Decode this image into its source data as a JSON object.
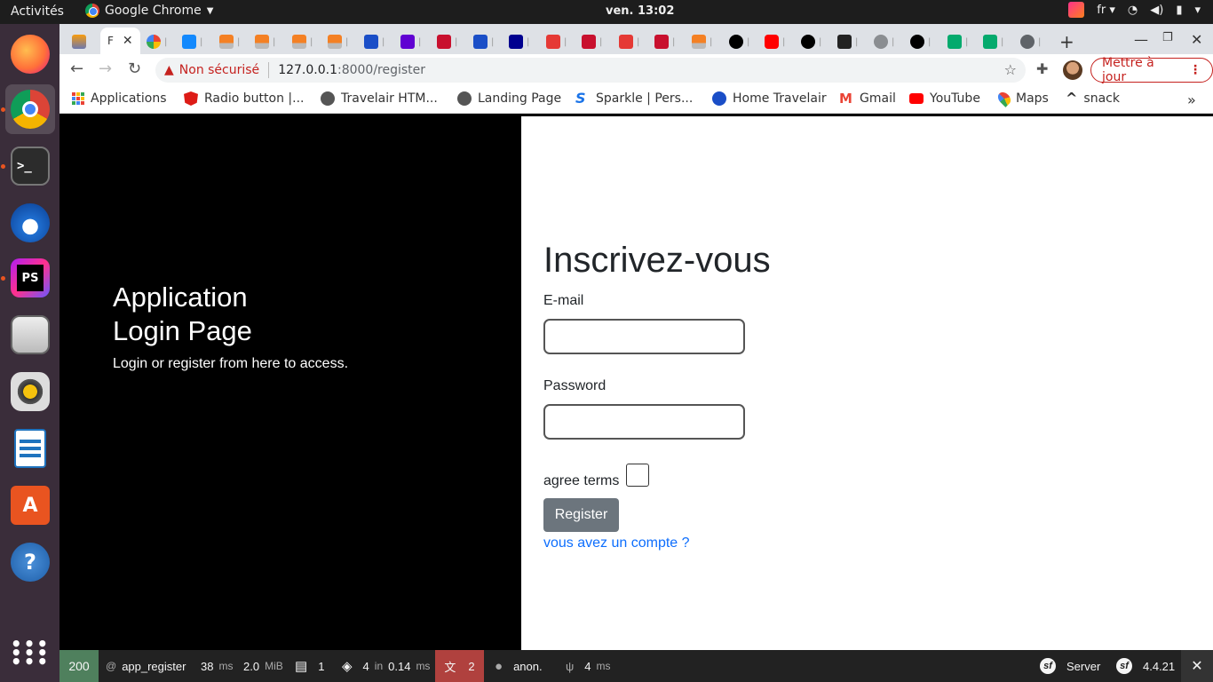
{
  "system": {
    "activities": "Activités",
    "app_name": "Google Chrome",
    "clock": "ven. 13:02",
    "lang": "fr"
  },
  "dock": {
    "items": [
      "firefox-icon",
      "chrome-icon",
      "terminal-icon",
      "thunderbird-icon",
      "phpstorm-icon",
      "files-icon",
      "rhythmbox-icon",
      "writer-icon",
      "software-icon",
      "help-icon",
      "apps-grid-icon"
    ],
    "phpstorm_label": "PS"
  },
  "browser": {
    "active_tab_label": "F",
    "new_tab": "+",
    "omnibox": {
      "insecure": "Non sécurisé",
      "host": "127.0.0.1",
      "path": ":8000/register"
    },
    "update_button": "Mettre à jour",
    "bookmarks": [
      {
        "label": "Applications",
        "color": "#4285f4"
      },
      {
        "label": "Radio button |...",
        "color": "#dd1b16"
      },
      {
        "label": "Travelair HTM...",
        "color": "#555555"
      },
      {
        "label": "Landing Page",
        "color": "#555555"
      },
      {
        "label": "Sparkle | Pers...",
        "color": "#1a73e8"
      },
      {
        "label": "Home Travelair",
        "color": "#1a4ec7"
      },
      {
        "label": "Gmail",
        "color": "#ea4335"
      },
      {
        "label": "YouTube",
        "color": "#ff0000"
      },
      {
        "label": "Maps",
        "color": "#34a853"
      },
      {
        "label": "snack",
        "color": "#111111"
      }
    ],
    "overflow": "»"
  },
  "page": {
    "hero_title_line1": "Application",
    "hero_title_line2": "Login Page",
    "hero_subtitle": "Login or register from here to access.",
    "form_title": "Inscrivez-vous",
    "email_label": "E-mail",
    "password_label": "Password",
    "agree_label": "agree terms",
    "register_button": "Register",
    "login_link": "vous avez un compte ?"
  },
  "profiler": {
    "status": "200",
    "route": "app_register",
    "time": "38",
    "time_unit": "ms",
    "memory": "2.0",
    "memory_unit": "MiB",
    "forms": "1",
    "cache": "4",
    "cache_in": "in",
    "cache_time": "0.14",
    "cache_unit": "ms",
    "translation_errors": "2",
    "user": "anon.",
    "twig": "4",
    "twig_unit": "ms",
    "server": "Server",
    "version": "4.4.21",
    "colors": {
      "ok": "#4f805d",
      "error": "#b0413e"
    }
  }
}
